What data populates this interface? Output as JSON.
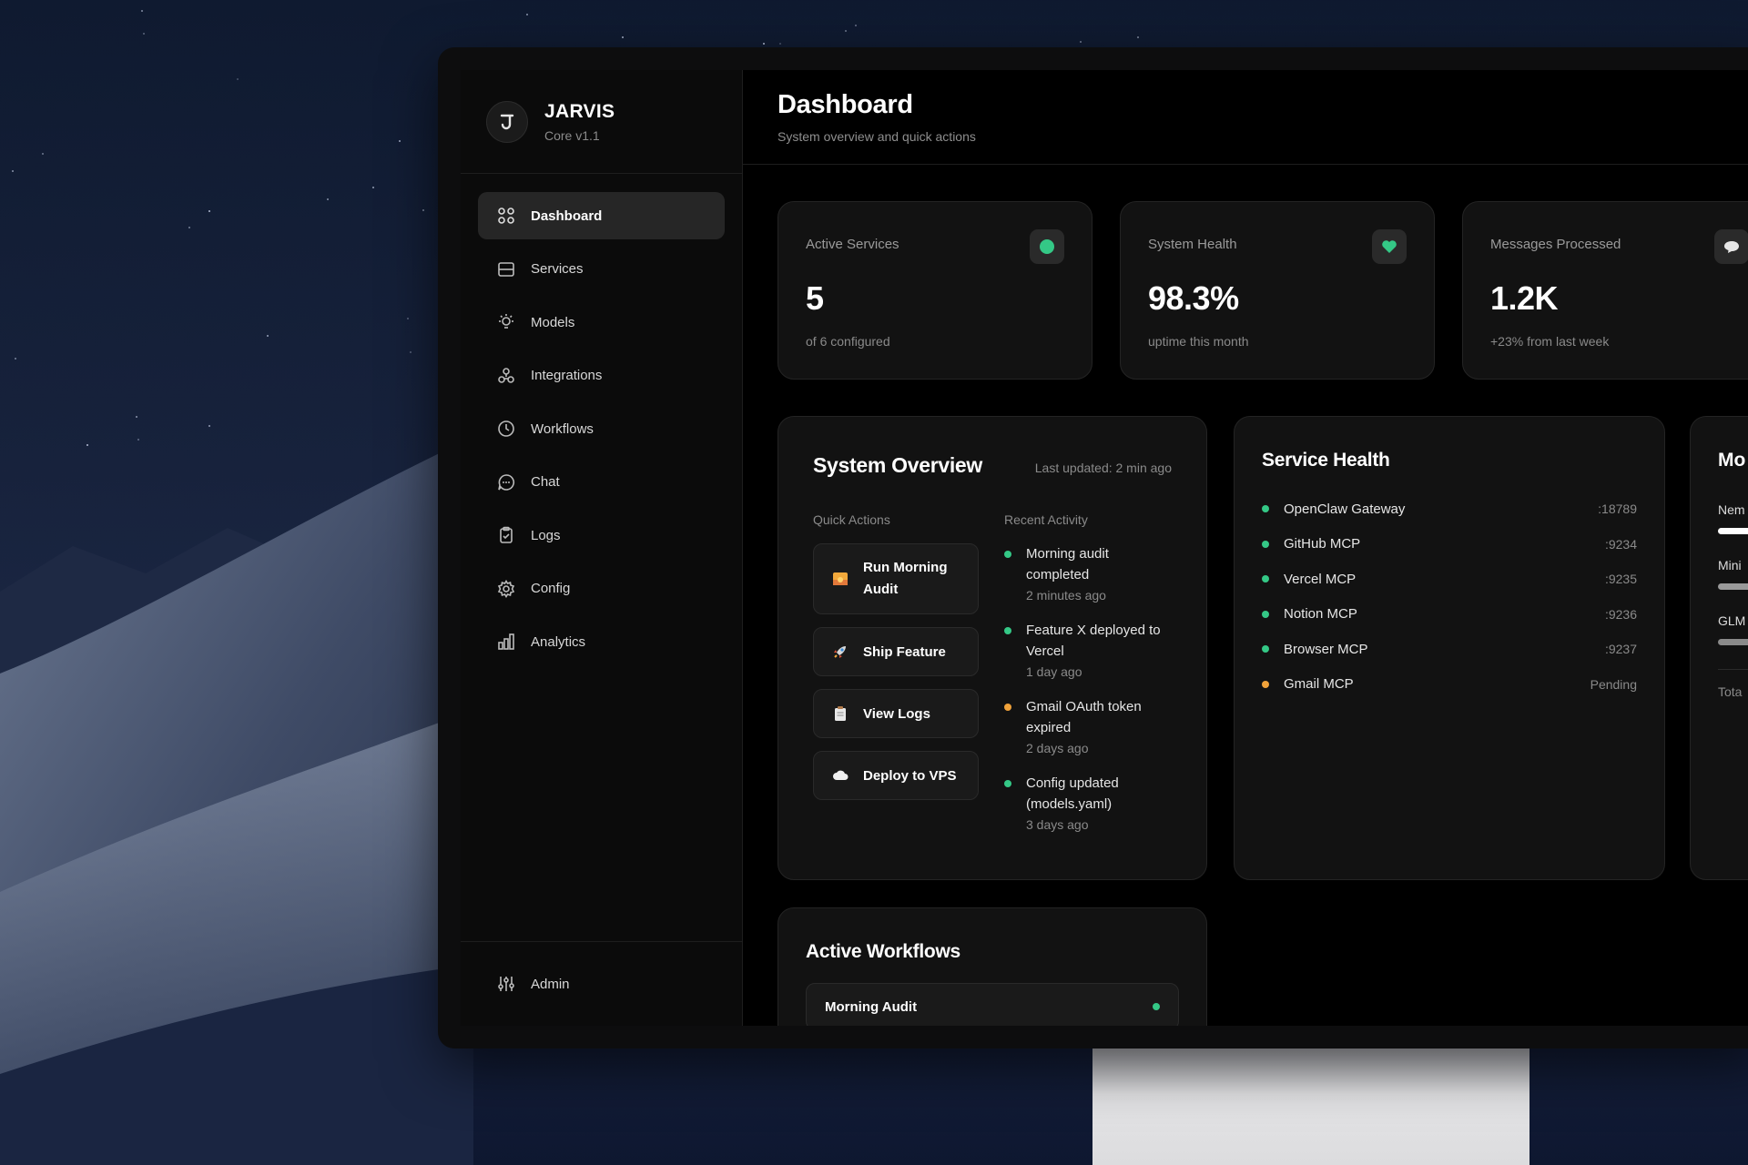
{
  "brand": {
    "title": "JARVIS",
    "subtitle": "Core v1.1"
  },
  "nav": {
    "items": [
      {
        "label": "Dashboard",
        "icon": "grid-icon",
        "active": true
      },
      {
        "label": "Services",
        "icon": "server-icon"
      },
      {
        "label": "Models",
        "icon": "bulb-icon"
      },
      {
        "label": "Integrations",
        "icon": "puzzle-icon"
      },
      {
        "label": "Workflows",
        "icon": "clock-icon"
      },
      {
        "label": "Chat",
        "icon": "chat-icon"
      },
      {
        "label": "Logs",
        "icon": "clipboard-icon"
      },
      {
        "label": "Config",
        "icon": "gear-icon"
      },
      {
        "label": "Analytics",
        "icon": "bar-chart-icon"
      }
    ],
    "bottom": {
      "label": "Admin",
      "icon": "sliders-icon"
    }
  },
  "header": {
    "title": "Dashboard",
    "subtitle": "System overview and quick actions"
  },
  "stats": [
    {
      "label": "Active Services",
      "value": "5",
      "foot": "of 6 configured",
      "icon": "status-dot-icon"
    },
    {
      "label": "System Health",
      "value": "98.3%",
      "foot": "uptime this month",
      "icon": "heart-icon"
    },
    {
      "label": "Messages Processed",
      "value": "1.2K",
      "foot": "+23% from last week",
      "icon": "message-icon"
    }
  ],
  "overview": {
    "title": "System Overview",
    "updated": "Last updated: 2 min ago",
    "quick_actions_label": "Quick Actions",
    "recent_activity_label": "Recent Activity",
    "quick_actions": [
      {
        "label": "Run Morning Audit",
        "icon": "sunrise-icon"
      },
      {
        "label": "Ship Feature",
        "icon": "rocket-icon"
      },
      {
        "label": "View Logs",
        "icon": "notepad-icon"
      },
      {
        "label": "Deploy to VPS",
        "icon": "cloud-icon"
      }
    ],
    "activity": [
      {
        "text": "Morning audit completed",
        "time": "2 minutes ago",
        "status": "success"
      },
      {
        "text": "Feature X deployed to Vercel",
        "time": "1 day ago",
        "status": "success"
      },
      {
        "text": "Gmail OAuth token expired",
        "time": "2 days ago",
        "status": "warning"
      },
      {
        "text": "Config updated (models.yaml)",
        "time": "3 days ago",
        "status": "success"
      }
    ]
  },
  "service_health": {
    "title": "Service Health",
    "services": [
      {
        "name": "OpenClaw Gateway",
        "port": ":18789",
        "status": "healthy"
      },
      {
        "name": "GitHub MCP",
        "port": ":9234",
        "status": "healthy"
      },
      {
        "name": "Vercel MCP",
        "port": ":9235",
        "status": "healthy"
      },
      {
        "name": "Notion MCP",
        "port": ":9236",
        "status": "healthy"
      },
      {
        "name": "Browser MCP",
        "port": ":9237",
        "status": "healthy"
      },
      {
        "name": "Gmail MCP",
        "port": "Pending",
        "status": "pending"
      }
    ]
  },
  "models_card": {
    "title": "Mo",
    "rows": [
      {
        "name": "Nem",
        "bar_color": "#ffffff"
      },
      {
        "name": "Mini",
        "bar_color": "#9a9a9a"
      },
      {
        "name": "GLM",
        "bar_color": "#8a8a8a"
      }
    ],
    "footer": "Tota"
  },
  "workflows": {
    "title": "Active Workflows",
    "items": [
      {
        "name": "Morning Audit",
        "status": "running"
      }
    ]
  },
  "colors": {
    "success": "#34c886",
    "warning": "#f0a23a",
    "accent_bg": "#262626"
  }
}
